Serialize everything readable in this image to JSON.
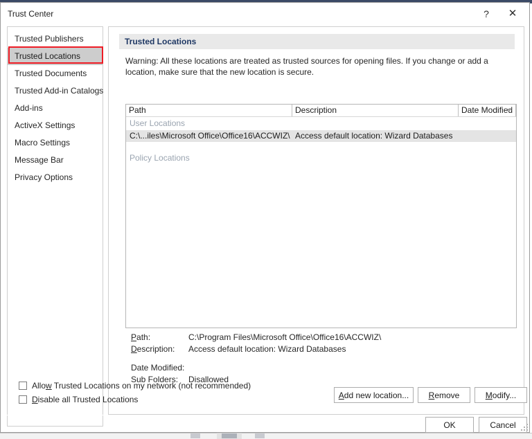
{
  "window": {
    "title": "Trust Center",
    "help_icon": "question-mark-icon",
    "help_label": "?",
    "close_icon": "close-icon",
    "close_label": "✕"
  },
  "sidebar": {
    "items": [
      {
        "label": "Trusted Publishers",
        "selected": false
      },
      {
        "label": "Trusted Locations",
        "selected": true
      },
      {
        "label": "Trusted Documents",
        "selected": false
      },
      {
        "label": "Trusted Add-in Catalogs",
        "selected": false
      },
      {
        "label": "Add-ins",
        "selected": false
      },
      {
        "label": "ActiveX Settings",
        "selected": false
      },
      {
        "label": "Macro Settings",
        "selected": false
      },
      {
        "label": "Message Bar",
        "selected": false
      },
      {
        "label": "Privacy Options",
        "selected": false
      }
    ],
    "highlight_color": "#ee1c25",
    "selected_bg": "#cdcdcd"
  },
  "main": {
    "panel_title": "Trusted Locations",
    "panel_title_color": "#1f3864",
    "warning": "Warning: All these locations are treated as trusted sources for opening files.  If you change or add a location, make sure that the new location is secure.",
    "list": {
      "columns": [
        {
          "label": "Path"
        },
        {
          "label": "Description"
        },
        {
          "label": "Date Modified",
          "sort_icon": "chevron-down-icon"
        }
      ],
      "groups": [
        {
          "label": "User Locations",
          "rows": [
            {
              "path": "C:\\...iles\\Microsoft Office\\Office16\\ACCWIZ\\",
              "description": "Access default location: Wizard Databases",
              "date_modified": "",
              "selected": true
            }
          ]
        },
        {
          "label": "Policy Locations",
          "rows": []
        }
      ]
    },
    "details": {
      "path_label": "Path:",
      "path_accel": "P",
      "path_value": "C:\\Program Files\\Microsoft Office\\Office16\\ACCWIZ\\",
      "description_label": "Description:",
      "description_accel": "D",
      "description_value": "Access default location: Wizard Databases",
      "date_modified_label": "Date Modified:",
      "date_modified_value": "",
      "sub_folders_label": "Sub Folders:",
      "sub_folders_value": "Disallowed"
    },
    "buttons": {
      "add": {
        "label": "Add new location...",
        "accel": "A",
        "before": "",
        "after": "dd new location..."
      },
      "remove": {
        "label": "Remove",
        "accel": "R",
        "before": "",
        "after": "emove"
      },
      "modify": {
        "label": "Modify...",
        "accel": "M",
        "before": "",
        "after": "odify..."
      }
    },
    "checkboxes": [
      {
        "label": "Allow Trusted Locations on my network (not recommended)",
        "before": "Allo",
        "accel": "w",
        "after": " Trusted Locations on my network (not recommended)",
        "checked": false
      },
      {
        "label": "Disable all Trusted Locations",
        "before": "",
        "accel": "D",
        "after": "isable all Trusted Locations",
        "checked": false
      }
    ]
  },
  "footer": {
    "ok_label": "OK",
    "cancel_label": "Cancel"
  }
}
